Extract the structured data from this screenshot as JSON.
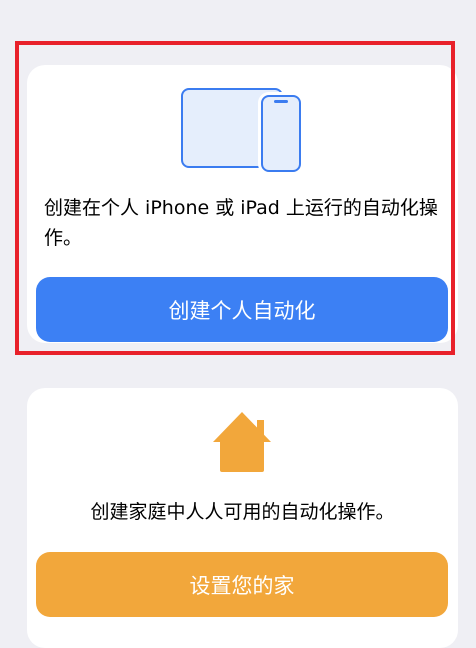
{
  "personal_card": {
    "icon": "iphone-ipad-icon",
    "description": "创建在个人 iPhone 或 iPad 上运行的自动化操作。",
    "button_label": "创建个人自动化",
    "button_color": "#3c80f4"
  },
  "home_card": {
    "icon": "house-icon",
    "description": "创建家庭中人人可用的自动化操作。",
    "button_label": "设置您的家",
    "button_color": "#f2a73b"
  },
  "highlight_color": "#e8212a"
}
